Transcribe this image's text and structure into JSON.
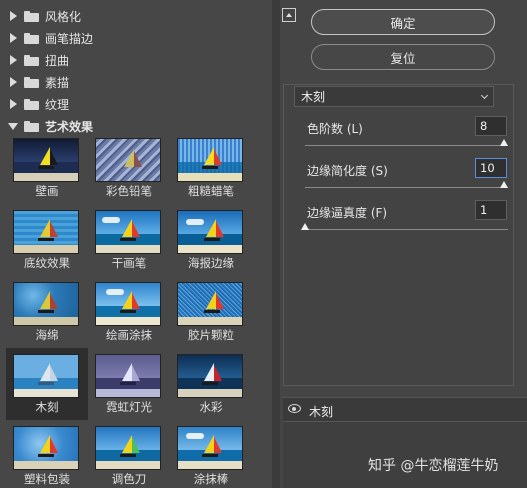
{
  "gallery": {
    "categories": [
      {
        "label": "风格化",
        "state": "collapsed"
      },
      {
        "label": "画笔描边",
        "state": "collapsed"
      },
      {
        "label": "扭曲",
        "state": "collapsed"
      },
      {
        "label": "素描",
        "state": "collapsed"
      },
      {
        "label": "纹理",
        "state": "collapsed"
      },
      {
        "label": "艺术效果",
        "state": "expanded"
      }
    ],
    "filters": [
      {
        "label": "壁画"
      },
      {
        "label": "彩色铅笔"
      },
      {
        "label": "粗糙蜡笔"
      },
      {
        "label": "底纹效果"
      },
      {
        "label": "干画笔"
      },
      {
        "label": "海报边缘"
      },
      {
        "label": "海绵"
      },
      {
        "label": "绘画涂抹"
      },
      {
        "label": "胶片颗粒"
      },
      {
        "label": "木刻",
        "selected": true
      },
      {
        "label": "霓虹灯光"
      },
      {
        "label": "水彩"
      },
      {
        "label": "塑料包装"
      },
      {
        "label": "调色刀"
      },
      {
        "label": "涂抹棒"
      }
    ]
  },
  "buttons": {
    "ok": "确定",
    "reset": "复位"
  },
  "settings": {
    "filter_selected": "木刻",
    "params": [
      {
        "label": "色阶数 (L)",
        "value": "8",
        "level": 1.0
      },
      {
        "label": "边缘简化度 (S)",
        "value": "10",
        "level": 1.0,
        "focused": true
      },
      {
        "label": "边缘逼真度 (F)",
        "value": "1",
        "level": 0.0
      }
    ]
  },
  "layers": {
    "items": [
      {
        "name": "木刻",
        "visible": true
      }
    ]
  },
  "watermark": "知乎 @牛恋榴莲牛奶",
  "colors": {
    "panel_bg": "#454545",
    "focus_border": "#5b8fd6",
    "slider_knob": "#f0f0f0"
  }
}
